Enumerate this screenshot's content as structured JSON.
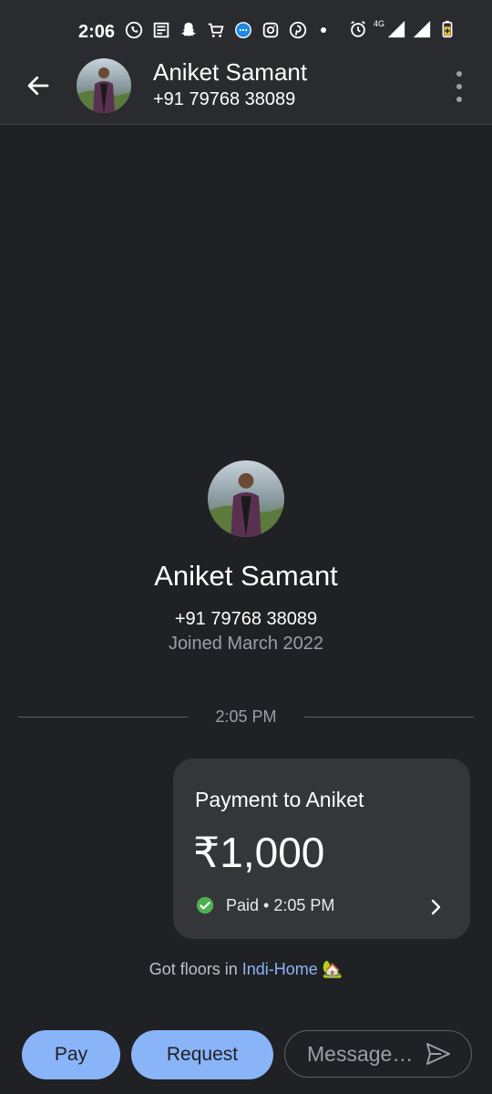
{
  "status_bar": {
    "time": "2:06",
    "icons_left": [
      "whatsapp-icon",
      "news-icon",
      "snapchat-icon",
      "cart-icon",
      "chat-bubble-icon",
      "instagram-icon",
      "pinterest-icon"
    ],
    "icons_right": [
      "alarm-icon",
      "network-4g-icon",
      "signal-icon",
      "signal-icon",
      "battery-icon"
    ],
    "network_label": "4G"
  },
  "header": {
    "name": "Aniket Samant",
    "phone": "+91 79768 38089"
  },
  "profile": {
    "name": "Aniket Samant",
    "phone": "+91 79768 38089",
    "joined": "Joined March 2022"
  },
  "conversation": {
    "timestamp": "2:05 PM",
    "payment": {
      "title": "Payment to Aniket",
      "amount": "₹1,000",
      "status": "Paid • 2:05 PM"
    },
    "note": {
      "prefix": "Got floors in ",
      "link": "Indi-Home",
      "emoji": "🏡"
    }
  },
  "bottom_bar": {
    "pay_label": "Pay",
    "request_label": "Request",
    "message_placeholder": "Message…"
  },
  "colors": {
    "background": "#202124",
    "card": "#35363a",
    "accent": "#8ab4f8",
    "success": "#4caf50"
  }
}
